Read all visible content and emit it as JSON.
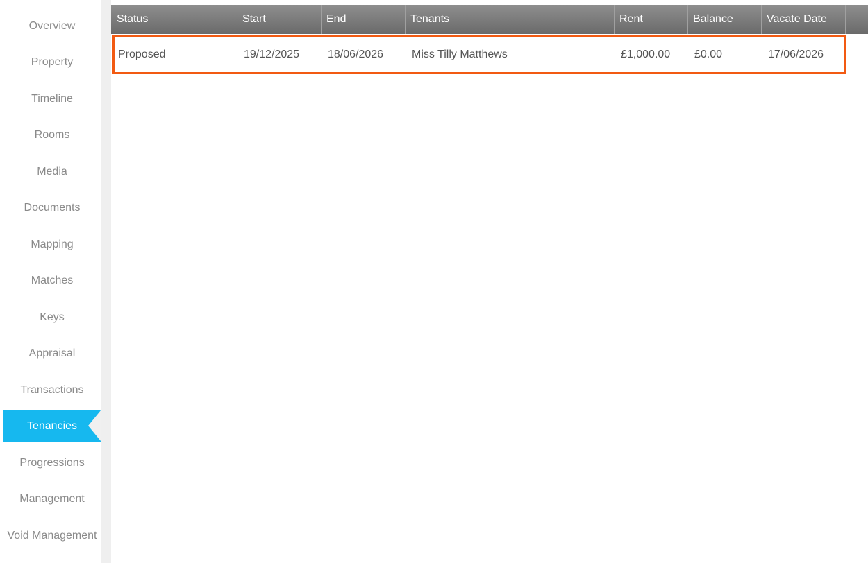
{
  "sidebar": {
    "items": [
      {
        "label": "Overview"
      },
      {
        "label": "Property"
      },
      {
        "label": "Timeline"
      },
      {
        "label": "Rooms"
      },
      {
        "label": "Media"
      },
      {
        "label": "Documents"
      },
      {
        "label": "Mapping"
      },
      {
        "label": "Matches"
      },
      {
        "label": "Keys"
      },
      {
        "label": "Appraisal"
      },
      {
        "label": "Transactions"
      },
      {
        "label": "Tenancies"
      },
      {
        "label": "Progressions"
      },
      {
        "label": "Management"
      },
      {
        "label": "Void Management"
      }
    ],
    "active": "Tenancies"
  },
  "table": {
    "columns": [
      "Status",
      "Start",
      "End",
      "Tenants",
      "Rent",
      "Balance",
      "Vacate Date"
    ],
    "rows": [
      {
        "status": "Proposed",
        "start": "19/12/2025",
        "end": "18/06/2026",
        "tenants": "Miss Tilly Matthews",
        "rent": "£1,000.00",
        "balance": "£0.00",
        "vacate_date": "17/06/2026"
      }
    ]
  },
  "colors": {
    "active_tab": "#16b8ef",
    "header": "#7a7a7a",
    "highlight": "#f25a12"
  }
}
